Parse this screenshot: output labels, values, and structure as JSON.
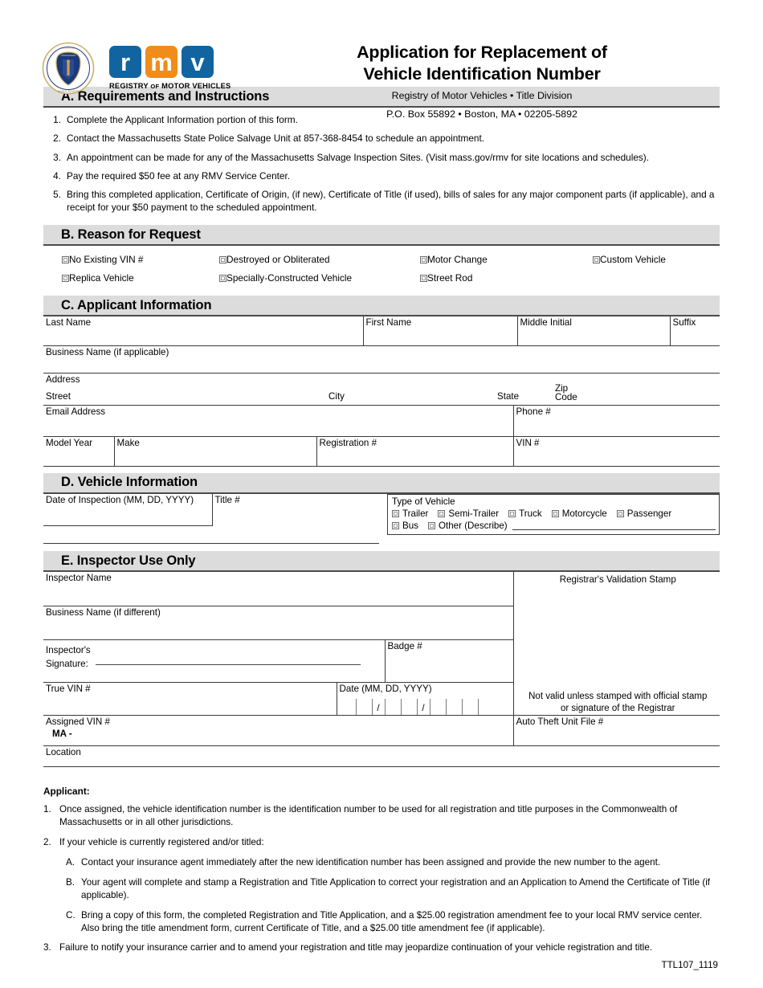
{
  "header": {
    "seal_name": "massachusetts-state-seal",
    "logo": {
      "letters": [
        "r",
        "m",
        "v"
      ],
      "colors": [
        "#1164a0",
        "#f08c1b",
        "#1164a0"
      ],
      "subtitle_pre": "REGISTRY ",
      "subtitle_of": "OF",
      "subtitle_post": " MOTOR VEHICLES"
    },
    "title_line1": "Application for Replacement of",
    "title_line2": "Vehicle Identification Number",
    "subtitle_line1": "Registry of Motor Vehicles • Title Division",
    "subtitle_line2": "P.O. Box 55892 • Boston, MA • 02205-5892"
  },
  "section_a": {
    "heading": "A. Requirements and Instructions",
    "items": [
      {
        "num": "1.",
        "text": "Complete the Applicant Information portion of this form."
      },
      {
        "num": "2.",
        "text": "Contact the Massachusetts State Police Salvage Unit at 857-368-8454 to schedule an appointment."
      },
      {
        "num": "3.",
        "text": "An appointment can be made for any of the Massachusetts Salvage Inspection Sites. (Visit mass.gov/rmv for site locations and schedules)."
      },
      {
        "num": "4.",
        "text": "Pay the required $50 fee at any RMV Service Center."
      },
      {
        "num": "5.",
        "text": "Bring this completed application, Certificate of Origin, (if new), Certificate of Title (if used), bills of sales for any major component parts (if applicable), and a receipt for your $50 payment to the scheduled appointment."
      }
    ]
  },
  "section_b": {
    "heading": "B. Reason for Request",
    "options_row1": [
      "No Existing VIN #",
      "Destroyed or Obliterated",
      "Motor Change",
      "Custom Vehicle"
    ],
    "options_row2": [
      "Replica Vehicle",
      "Specially-Constructed Vehicle",
      "Street Rod"
    ]
  },
  "section_c": {
    "heading": "C. Applicant Information",
    "last_name": "Last Name",
    "first_name": "First Name",
    "middle_initial": "Middle Initial",
    "suffix": "Suffix",
    "business_name": "Business Name (if applicable)",
    "address": "Address",
    "street": "Street",
    "city": "City",
    "state": "State",
    "zip_line1": "Zip",
    "zip_line2": "Code",
    "email": "Email Address",
    "phone": "Phone #",
    "model_year": "Model Year",
    "make": "Make",
    "registration": "Registration #",
    "vin": "VIN #"
  },
  "section_d": {
    "heading": "D. Vehicle Information",
    "date_of_inspection": "Date of Inspection (MM, DD, YYYY)",
    "title_number": "Title #",
    "type_of_vehicle": "Type of Vehicle",
    "types_row1": [
      "Trailer",
      "Semi-Trailer",
      "Truck",
      "Motorcycle",
      "Passenger"
    ],
    "types_row2": [
      "Bus",
      "Other (Describe)"
    ]
  },
  "section_e": {
    "heading": "E. Inspector Use Only",
    "inspector_name": "Inspector Name",
    "business_name_diff": "Business Name (if different)",
    "signature_line1": "Inspector's",
    "signature_line2": "Signature:",
    "badge": "Badge #",
    "true_vin": "True VIN #",
    "date_label": "Date (MM, DD, YYYY)",
    "date_separator": "/",
    "assigned_vin": "Assigned VIN #",
    "assigned_vin_prefix": "MA -",
    "location": "Location",
    "validation_stamp": "Registrar's Validation Stamp",
    "stamp_note_line1": "Not valid unless stamped with official stamp",
    "stamp_note_line2": "or signature of the Registrar",
    "auto_theft": "Auto Theft Unit File #"
  },
  "footer": {
    "applicant_heading": "Applicant:",
    "notes": [
      {
        "num": "1.",
        "sub": false,
        "text": "Once assigned, the vehicle identification number is the identification number to be used for all registration and title purposes in the Commonwealth of Massachusetts or in all other jurisdictions."
      },
      {
        "num": "2.",
        "sub": false,
        "text": "If your vehicle is currently registered and/or titled:"
      },
      {
        "num": "A.",
        "sub": true,
        "text": "Contact your insurance agent immediately after the new identification number has been assigned and provide the new number to the agent."
      },
      {
        "num": "B.",
        "sub": true,
        "text": "Your agent will complete and stamp a Registration and Title Application to correct your registration and an Application to Amend the Certificate of Title (if applicable)."
      },
      {
        "num": "C.",
        "sub": true,
        "text": "Bring a copy of this form, the completed Registration and Title Application, and a $25.00 registration amendment fee to your local RMV service center. Also bring the title amendment form, current Certificate of Title, and a $25.00 title amendment fee (if applicable)."
      },
      {
        "num": "3.",
        "sub": false,
        "text": "Failure to notify your insurance carrier and to amend your registration and title may jeopardize continuation of your vehicle registration and title."
      }
    ],
    "form_code": "TTL107_1119"
  },
  "colors": {
    "bar_background": "#dcdcdc",
    "rule": "#3a3a3a",
    "logo_blue": "#1164a0",
    "logo_orange": "#f08c1b"
  }
}
